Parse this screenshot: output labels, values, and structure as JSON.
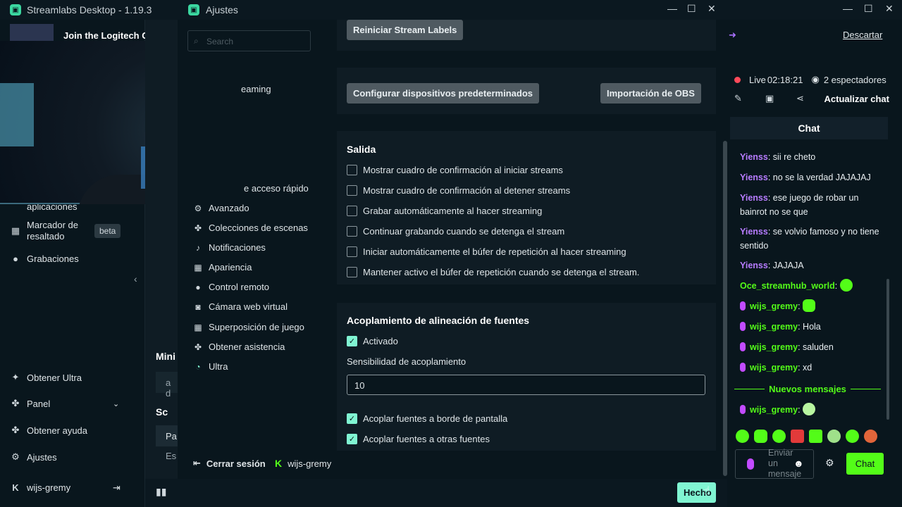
{
  "main_window": {
    "title": "Streamlabs Desktop - 1.19.3",
    "banner_text": "Join the Logitech G PLAY ca"
  },
  "sidebar": {
    "items": [
      {
        "label": "aplicaciones",
        "icon": "apps-icon"
      },
      {
        "label": "Marcador de resaltado",
        "icon": "highlight-icon"
      },
      {
        "label": "Grabaciones",
        "icon": "recordings-icon"
      },
      {
        "label": "Obtener Ultra",
        "icon": "ultra-icon"
      },
      {
        "label": "Panel",
        "icon": "panel-icon"
      },
      {
        "label": "Obtener ayuda",
        "icon": "help-icon"
      },
      {
        "label": "Ajustes",
        "icon": "gear-icon"
      }
    ],
    "beta_badge": "beta",
    "username": "wijs-gremy"
  },
  "center": {
    "mini_label": "Mini",
    "mini_input": "a d",
    "sc_label": "Sc",
    "pa_label": "Pa",
    "es_label": "Es",
    "done_button": "Hecho"
  },
  "settings": {
    "title": "Ajustes",
    "search_placeholder": "Search",
    "nav_partial_1": "eaming",
    "nav_partial_2": "e acceso rápido",
    "nav": [
      {
        "label": "Avanzado",
        "icon": "gear-icon"
      },
      {
        "label": "Colecciones de escenas",
        "icon": "collections-icon"
      },
      {
        "label": "Notificaciones",
        "icon": "bell-icon"
      },
      {
        "label": "Apariencia",
        "icon": "appearance-icon"
      },
      {
        "label": "Control remoto",
        "icon": "remote-icon"
      },
      {
        "label": "Cámara web virtual",
        "icon": "camera-icon"
      },
      {
        "label": "Superposición de juego",
        "icon": "overlay-icon"
      },
      {
        "label": "Obtener asistencia",
        "icon": "help-icon"
      },
      {
        "label": "Ultra",
        "icon": "ultra-icon"
      }
    ],
    "logout": "Cerrar sesión",
    "username": "wijs-gremy",
    "buttons": {
      "restart_labels": "Reiniciar Stream Labels",
      "configure_devices": "Configurar dispositivos predeterminados",
      "obs_import": "Importación de OBS"
    },
    "output": {
      "title": "Salida",
      "options": [
        {
          "label": "Mostrar cuadro de confirmación al iniciar streams",
          "checked": false
        },
        {
          "label": "Mostrar cuadro de confirmación al detener streams",
          "checked": false
        },
        {
          "label": "Grabar automáticamente al hacer streaming",
          "checked": false
        },
        {
          "label": "Continuar grabando cuando se detenga el stream",
          "checked": false
        },
        {
          "label": "Iniciar automáticamente el búfer de repetición al hacer streaming",
          "checked": false
        },
        {
          "label": "Mantener activo el búfer de repetición cuando se detenga el stream.",
          "checked": false
        }
      ]
    },
    "snapping": {
      "title": "Acoplamiento de alineación de fuentes",
      "enabled_label": "Activado",
      "sensitivity_label": "Sensibilidad de acoplamiento",
      "sensitivity_value": "10",
      "options": [
        {
          "label": "Acoplar fuentes a borde de pantalla",
          "checked": true
        },
        {
          "label": "Acoplar fuentes a otras fuentes",
          "checked": true
        }
      ]
    }
  },
  "chat": {
    "discard": "Descartar",
    "live_label": "Live",
    "live_time": "02:18:21",
    "viewers": "2 espectadores",
    "refresh": "Actualizar chat",
    "header": "Chat",
    "messages": [
      {
        "user": "Yienss",
        "text": "sii re cheto",
        "kind": "purple"
      },
      {
        "user": "Yienss",
        "text": "no se la verdad JAJAJAJ",
        "kind": "purple"
      },
      {
        "user": "Yienss",
        "text": "ese juego de robar un bainrot no se que",
        "kind": "purple"
      },
      {
        "user": "Yienss",
        "text": "se volvio famoso y no tiene sentido",
        "kind": "purple"
      },
      {
        "user": "Yienss",
        "text": "JAJAJA",
        "kind": "purple"
      },
      {
        "user": "Oce_streamhub_world",
        "text": "",
        "kind": "green",
        "emote": true
      },
      {
        "user": "wijs_gremy",
        "text": "",
        "kind": "green-mic",
        "emote": true
      },
      {
        "user": "wijs_gremy",
        "text": "Hola",
        "kind": "green-mic"
      },
      {
        "user": "wijs_gremy",
        "text": "saluden",
        "kind": "green-mic"
      },
      {
        "user": "wijs_gremy",
        "text": "xd",
        "kind": "green-mic"
      }
    ],
    "new_messages": "Nuevos mensajes",
    "after_new": {
      "user": "wijs_gremy",
      "text": ""
    },
    "input_placeholder": "Enviar un mensaje",
    "send": "Chat"
  },
  "colors": {
    "accent": "#80f5d2",
    "kick_green": "#53fc18",
    "purple_user": "#b77cff",
    "live_red": "#ff4a5a"
  }
}
